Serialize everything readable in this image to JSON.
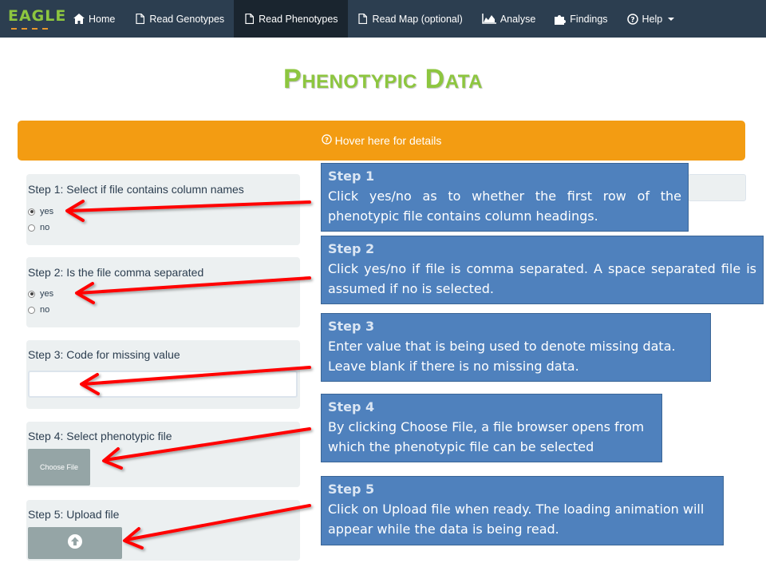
{
  "brand": {
    "name": "EAGLE"
  },
  "nav": {
    "items": [
      {
        "label": "Home",
        "icon": "home-icon"
      },
      {
        "label": "Read Genotypes",
        "icon": "file-icon"
      },
      {
        "label": "Read Phenotypes",
        "icon": "file-icon",
        "active": true
      },
      {
        "label": "Read Map (optional)",
        "icon": "file-icon"
      },
      {
        "label": "Analyse",
        "icon": "area-chart-icon"
      },
      {
        "label": "Findings",
        "icon": "puzzle-icon"
      },
      {
        "label": "Help",
        "icon": "question-circle-icon"
      }
    ]
  },
  "page": {
    "title": "Phenotypic Data"
  },
  "hover_bar": {
    "label": "Hover here for details"
  },
  "steps": {
    "step1": {
      "label": "Step 1: Select if file contains column names",
      "options": [
        "yes",
        "no"
      ],
      "selected": "yes"
    },
    "step2": {
      "label": "Step 2: Is the file comma separated",
      "options": [
        "yes",
        "no"
      ],
      "selected": "yes"
    },
    "step3": {
      "label": "Step 3: Code for missing value",
      "value": ""
    },
    "step4": {
      "label": "Step 4: Select phenotypic file",
      "button": "Choose File"
    },
    "step5": {
      "label": "Step 5: Upload file"
    }
  },
  "callouts": {
    "c1": {
      "title": "Step 1",
      "body": "Click yes/no as to whether the first row of the phenotypic file contains column headings."
    },
    "c2": {
      "title": "Step 2",
      "body": "Click yes/no if file is comma separated.  A space separated file is assumed if no is selected."
    },
    "c3": {
      "title": "Step 3",
      "body": "Enter value that is being used to denote missing data. Leave blank if there is no missing data."
    },
    "c4": {
      "title": "Step 4",
      "body": "By clicking Choose File, a file browser opens from which the phenotypic file can be selected"
    },
    "c5": {
      "title": "Step 5",
      "body": "Click on Upload file when ready.  The loading animation will appear while the data is being read."
    }
  },
  "colors": {
    "navbar": "#2c3e50",
    "brand_green": "#8dc63f",
    "orange": "#f39c12",
    "callout_blue": "#4f81bd",
    "arrow_red": "#ff0000"
  }
}
